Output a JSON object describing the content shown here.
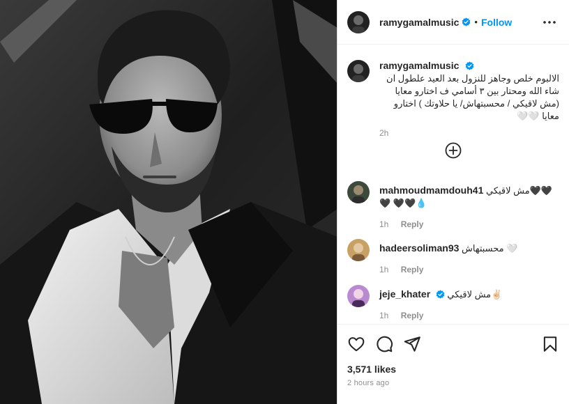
{
  "post": {
    "username": "ramygamalmusic",
    "separator": "•",
    "follow_label": "Follow",
    "more_icon": "more-options-icon",
    "photo_description_icon": "post-photo"
  },
  "caption": {
    "username": "ramygamalmusic",
    "text": "الالبوم خلص وجاهز للنزول بعد العيد علطول ان شاء الله ومحتار بين ٣ أسامي ف اختارو معايا (مش لاقيكي / محسبتهاش/ يا حلاوتك ) اختارو معايا 🤍🤍",
    "age": "2h"
  },
  "load_more_icon": "plus-circle-icon",
  "comments": [
    {
      "username": "mahmoudmamdouh41",
      "text": "مش لاقيكي🖤🖤🖤 🖤🖤💧",
      "age": "1h",
      "reply_label": "Reply"
    },
    {
      "username": "hadeersoliman93",
      "text": "محسبتهاش 🤍",
      "age": "1h",
      "reply_label": "Reply"
    },
    {
      "username": "jeje_khater",
      "text": "مش لاقيكي✌🏻",
      "age": "1h",
      "reply_label": "Reply"
    }
  ],
  "footer": {
    "likes": "3,571 likes",
    "timestamp": "2 hours ago"
  },
  "colors": {
    "link_blue": "#0095f6",
    "text": "#262626",
    "muted": "#8e8e8e",
    "border": "#dbdbdb"
  }
}
